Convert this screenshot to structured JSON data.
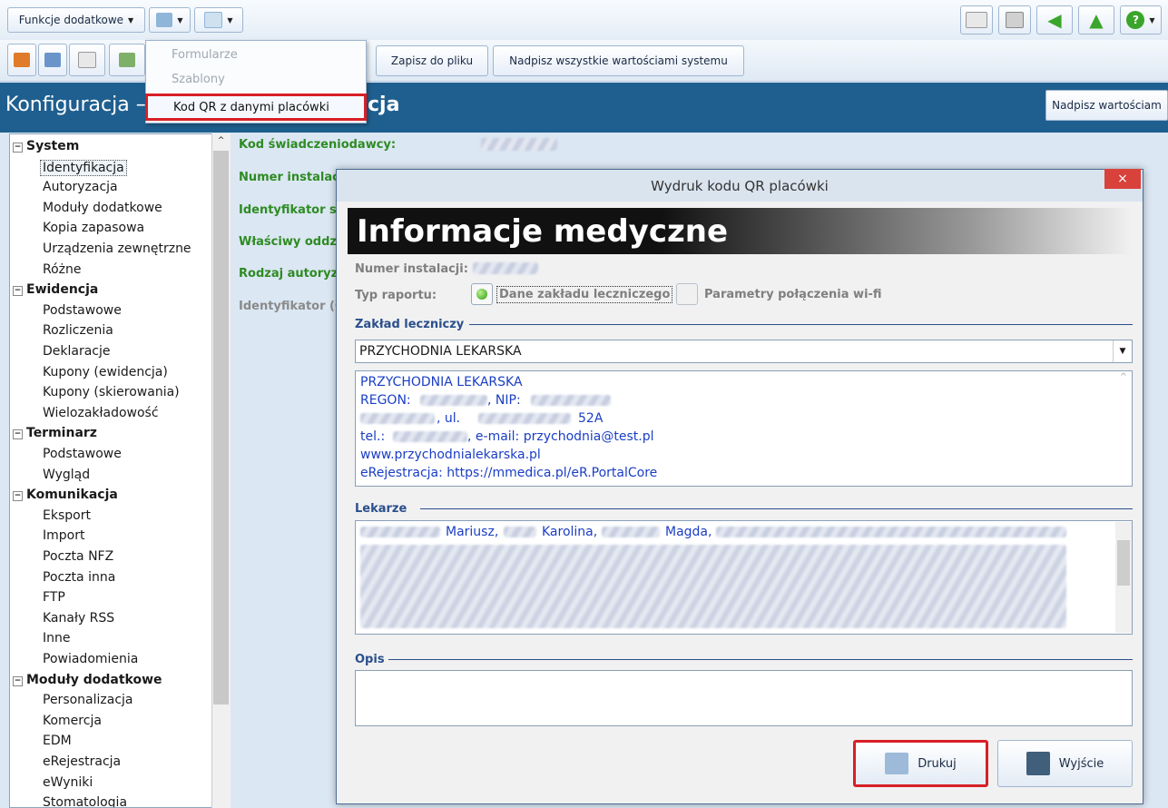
{
  "toolbar": {
    "extra_functions": "Funkcje dodatkowe",
    "save_to_file": "Zapisz do pliku",
    "overwrite_all": "Nadpisz wszystkie wartościami systemu"
  },
  "menu": {
    "items": [
      "Formularze",
      "Szablony",
      "Kod QR z danymi placówki"
    ]
  },
  "window": {
    "title_left": "Konfiguracja –",
    "title_right": "cja",
    "overwrite_button": "Nadpisz wartościam"
  },
  "tree": {
    "groups": [
      {
        "label": "System",
        "items": [
          "Identyfikacja",
          "Autoryzacja",
          "Moduły dodatkowe",
          "Kopia zapasowa",
          "Urządzenia zewnętrzne",
          "Różne"
        ]
      },
      {
        "label": "Ewidencja",
        "items": [
          "Podstawowe",
          "Rozliczenia",
          "Deklaracje",
          "Kupony (ewidencja)",
          "Kupony (skierowania)",
          "Wielozakładowość"
        ]
      },
      {
        "label": "Terminarz",
        "items": [
          "Podstawowe",
          "Wygląd"
        ]
      },
      {
        "label": "Komunikacja",
        "items": [
          "Eksport",
          "Import",
          "Poczta NFZ",
          "Poczta inna",
          "FTP",
          "Kanały RSS",
          "Inne",
          "Powiadomienia"
        ]
      },
      {
        "label": "Moduły dodatkowe",
        "items": [
          "Personalizacja",
          "Komercja",
          "EDM",
          "eRejestracja",
          "eWyniki",
          "Stomatologia"
        ]
      }
    ]
  },
  "fields": {
    "labels": [
      "Kod świadczeniodawcy:",
      "Numer instalacj",
      "Identyfikator sy",
      "Właściwy oddzia",
      "Rodzaj autoryza",
      "Identyfikator (C"
    ]
  },
  "dialog": {
    "title": "Wydruk kodu QR placówki",
    "close": "×",
    "banner": "Informacje medyczne",
    "install_number_label": "Numer instalacji:",
    "report_type_label": "Typ raportu:",
    "option_facility": "Dane zakładu leczniczego",
    "option_wifi": "Parametry połączenia wi-fi",
    "section_facility": "Zakład leczniczy",
    "facility_selected": "PRZYCHODNIA LEKARSKA",
    "facility_details": {
      "line1": "PRZYCHODNIA LEKARSKA",
      "regon": "REGON:",
      "nip": ", NIP:",
      "ul": ", ul.",
      "number": "52A",
      "tel": "tel.:",
      "email": ", e-mail: przychodnia@test.pl",
      "www": "www.przychodnialekarska.pl",
      "erej": "eRejestracja: https://mmedica.pl/eR.PortalCore"
    },
    "section_doctors": "Lekarze",
    "doctors": [
      "Mariusz,",
      "Karolina,",
      "Magda,"
    ],
    "section_description": "Opis",
    "print_button": "Drukuj",
    "exit_button": "Wyjście"
  },
  "colors": {
    "title_bar": "#1f5f8f",
    "highlight": "#d81f26",
    "field_label": "#2e8b22",
    "link_text": "#1a3ec4"
  }
}
